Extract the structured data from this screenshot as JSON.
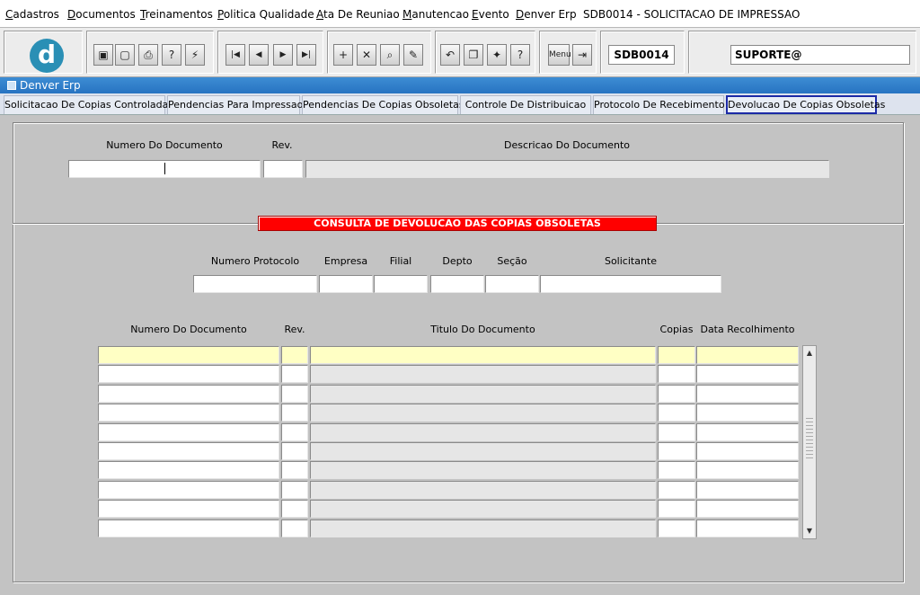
{
  "menu": {
    "items": [
      "Cadastros",
      "Documentos",
      "Treinamentos",
      "Politica Qualidade",
      "Ata De Reuniao",
      "Manutencao",
      "Evento",
      "Denver Erp"
    ],
    "window_title": "SDB0014 - SOLICITACAO DE IMPRESSAO"
  },
  "toolbar": {
    "logo_letter": "d",
    "form_code": "SDB0014",
    "user": "SUPORTE@",
    "menu_button": "Menu"
  },
  "window": {
    "title": "Denver Erp"
  },
  "tabs": [
    {
      "label": "Solicitacao De Copias Controladas",
      "active": false
    },
    {
      "label": "Pendencias Para Impressao",
      "active": false
    },
    {
      "label": "Pendencias De Copias Obsoletas",
      "active": false
    },
    {
      "label": "Controle De Distribuicao",
      "active": false
    },
    {
      "label": "Protocolo De Recebimento",
      "active": false
    },
    {
      "label": "Devolucao De Copias Obsoletas",
      "active": true
    }
  ],
  "header_fields": {
    "numero_label": "Numero Do Documento",
    "rev_label": "Rev.",
    "descricao_label": "Descricao Do Documento",
    "numero_value": "",
    "rev_value": "",
    "descricao_value": ""
  },
  "banner": "CONSULTA DE DEVOLUCAO DAS COPIAS OBSOLETAS",
  "protocol": {
    "labels": {
      "protocolo": "Numero Protocolo",
      "empresa": "Empresa",
      "filial": "Filial",
      "depto": "Depto",
      "secao": "Seção",
      "solicitante": "Solicitante"
    },
    "values": {
      "protocolo": "",
      "empresa": "",
      "filial": "",
      "depto": "",
      "secao": "",
      "solicitante": ""
    }
  },
  "grid": {
    "columns": [
      "Numero Do Documento",
      "Rev.",
      "Titulo Do Documento",
      "Copias",
      "Data Recolhimento"
    ],
    "rows": [
      [
        "",
        "",
        "",
        "",
        ""
      ],
      [
        "",
        "",
        "",
        "",
        ""
      ],
      [
        "",
        "",
        "",
        "",
        ""
      ],
      [
        "",
        "",
        "",
        "",
        ""
      ],
      [
        "",
        "",
        "",
        "",
        ""
      ],
      [
        "",
        "",
        "",
        "",
        ""
      ],
      [
        "",
        "",
        "",
        "",
        ""
      ],
      [
        "",
        "",
        "",
        "",
        ""
      ],
      [
        "",
        "",
        "",
        "",
        ""
      ],
      [
        "",
        "",
        "",
        "",
        ""
      ]
    ]
  },
  "colors": {
    "selected_row": "#ffffc4",
    "banner": "#ff0000",
    "window_bar": "#2773c2",
    "active_tab_border": "#1c2aa6"
  }
}
